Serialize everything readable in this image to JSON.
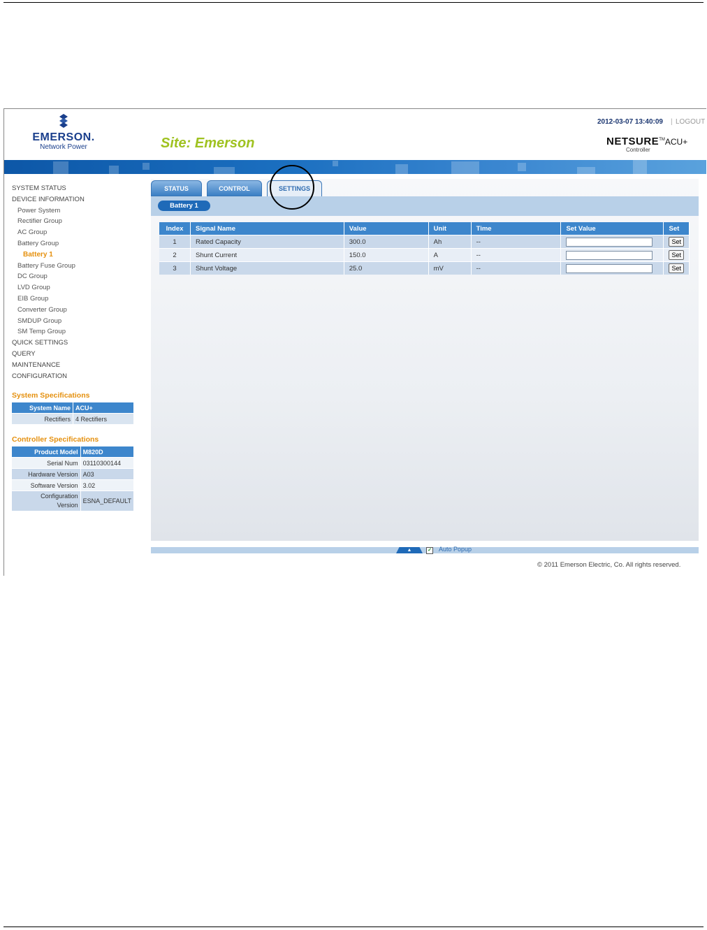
{
  "header": {
    "brand": "EMERSON.",
    "brand_sub": "Network Power",
    "site_title": "Site: Emerson",
    "datetime": "2012-03-07 13:40:09",
    "separator": "|",
    "logout": "LOGOUT",
    "product_main": "NETSURE",
    "product_tm": "TM",
    "product_tail": "ACU+",
    "product_sub": "Controller"
  },
  "nav": {
    "items": [
      {
        "label": "SYSTEM STATUS",
        "level": 1
      },
      {
        "label": "DEVICE INFORMATION",
        "level": 1
      },
      {
        "label": "Power System",
        "level": 2
      },
      {
        "label": "Rectifier Group",
        "level": 2
      },
      {
        "label": "AC Group",
        "level": 2
      },
      {
        "label": "Battery Group",
        "level": 2
      },
      {
        "label": "Battery 1",
        "level": 3
      },
      {
        "label": "Battery Fuse Group",
        "level": 2
      },
      {
        "label": "DC Group",
        "level": 2
      },
      {
        "label": "LVD Group",
        "level": 2
      },
      {
        "label": "EIB Group",
        "level": 2
      },
      {
        "label": "Converter Group",
        "level": 2
      },
      {
        "label": "SMDUP Group",
        "level": 2
      },
      {
        "label": "SM Temp Group",
        "level": 2
      },
      {
        "label": "QUICK SETTINGS",
        "level": 1
      },
      {
        "label": "QUERY",
        "level": 1
      },
      {
        "label": "MAINTENANCE",
        "level": 1
      },
      {
        "label": "CONFIGURATION",
        "level": 1
      }
    ]
  },
  "system_specs": {
    "title": "System Specifications",
    "rows": [
      {
        "key": "System Name",
        "value": "ACU+"
      },
      {
        "key": "Rectifiers",
        "value": "4 Rectifiers"
      }
    ]
  },
  "controller_specs": {
    "title": "Controller Specifications",
    "rows": [
      {
        "key": "Product Model",
        "value": "M820D"
      },
      {
        "key": "Serial Num",
        "value": "03110300144"
      },
      {
        "key": "Hardware Version",
        "value": "A03"
      },
      {
        "key": "Software Version",
        "value": "3.02"
      },
      {
        "key": "Configuration Version",
        "value": "ESNA_DEFAULT"
      }
    ]
  },
  "tabs": [
    {
      "label": "STATUS"
    },
    {
      "label": "CONTROL"
    },
    {
      "label": "SETTINGS"
    }
  ],
  "device_pill": "Battery 1",
  "table": {
    "headers": [
      "Index",
      "Signal Name",
      "Value",
      "Unit",
      "Time",
      "Set Value",
      "Set"
    ],
    "rows": [
      {
        "index": "1",
        "name": "Rated Capacity",
        "value": "300.0",
        "unit": "Ah",
        "time": "--",
        "set_value": "",
        "set_label": "Set"
      },
      {
        "index": "2",
        "name": "Shunt Current",
        "value": "150.0",
        "unit": "A",
        "time": "--",
        "set_value": "",
        "set_label": "Set"
      },
      {
        "index": "3",
        "name": "Shunt Voltage",
        "value": "25.0",
        "unit": "mV",
        "time": "--",
        "set_value": "",
        "set_label": "Set"
      }
    ]
  },
  "footer": {
    "auto_popup_checked": true,
    "auto_popup_label": "Auto Popup",
    "arrow_glyph": "▲",
    "check_glyph": "✓",
    "copyright": "© 2011 Emerson Electric, Co. All rights reserved."
  },
  "colors": {
    "accent_blue": "#3d86cc",
    "site_title_green": "#9fc220",
    "nav_orange": "#e5900e",
    "brand_blue": "#1a3f8c"
  }
}
